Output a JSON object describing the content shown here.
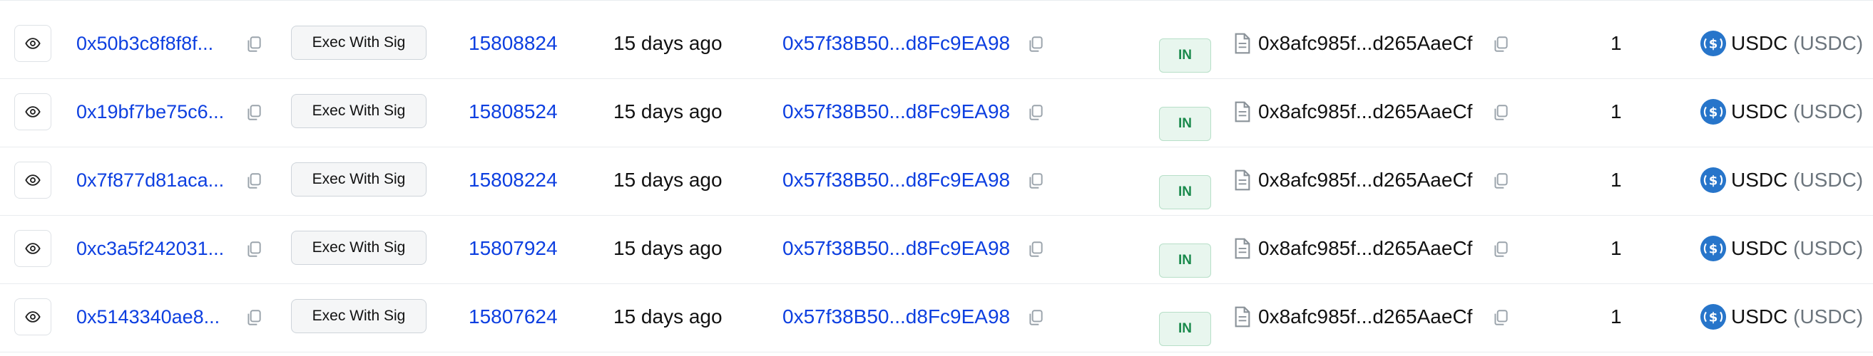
{
  "colors": {
    "link": "#0d3fe0",
    "text": "#111111",
    "muted": "#6c757d",
    "in_badge_bg": "#e8f6ee",
    "in_badge_text": "#1a8a4c",
    "usdc_blue": "#2775ca"
  },
  "icons": {
    "view": "eye-icon",
    "copy": "copy-icon",
    "contract": "document-icon",
    "token": "usdc-token-icon"
  },
  "transactions": [
    {
      "tx_hash": "0x50b3c8f8f8f...",
      "method": "Exec With Sig",
      "block": "15808824",
      "age": "15 days ago",
      "from": "0x57f38B50...d8Fc9EA98",
      "direction": "IN",
      "to": "0x8afc985f...d265AaeCf",
      "amount": "1",
      "token_name": "USDC",
      "token_symbol": "(USDC)"
    },
    {
      "tx_hash": "0x19bf7be75c6...",
      "method": "Exec With Sig",
      "block": "15808524",
      "age": "15 days ago",
      "from": "0x57f38B50...d8Fc9EA98",
      "direction": "IN",
      "to": "0x8afc985f...d265AaeCf",
      "amount": "1",
      "token_name": "USDC",
      "token_symbol": "(USDC)"
    },
    {
      "tx_hash": "0x7f877d81aca...",
      "method": "Exec With Sig",
      "block": "15808224",
      "age": "15 days ago",
      "from": "0x57f38B50...d8Fc9EA98",
      "direction": "IN",
      "to": "0x8afc985f...d265AaeCf",
      "amount": "1",
      "token_name": "USDC",
      "token_symbol": "(USDC)"
    },
    {
      "tx_hash": "0xc3a5f242031...",
      "method": "Exec With Sig",
      "block": "15807924",
      "age": "15 days ago",
      "from": "0x57f38B50...d8Fc9EA98",
      "direction": "IN",
      "to": "0x8afc985f...d265AaeCf",
      "amount": "1",
      "token_name": "USDC",
      "token_symbol": "(USDC)"
    },
    {
      "tx_hash": "0x5143340ae8...",
      "method": "Exec With Sig",
      "block": "15807624",
      "age": "15 days ago",
      "from": "0x57f38B50...d8Fc9EA98",
      "direction": "IN",
      "to": "0x8afc985f...d265AaeCf",
      "amount": "1",
      "token_name": "USDC",
      "token_symbol": "(USDC)"
    }
  ]
}
